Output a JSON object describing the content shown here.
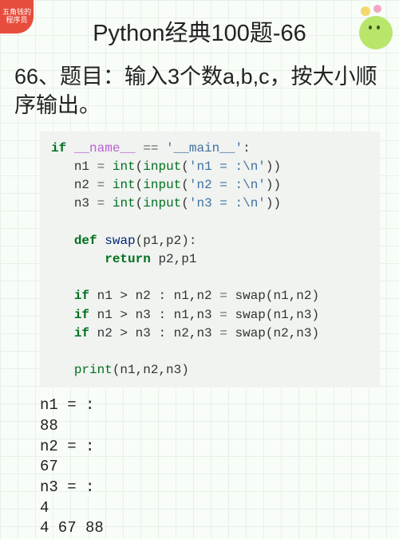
{
  "badge": {
    "line1": "五角钱的",
    "line2": "程序员"
  },
  "title": "Python经典100题-66",
  "question": "66、题目：输入3个数a,b,c，按大小顺序输出。",
  "code": {
    "l1_if": "if",
    "l1_name": "__name__",
    "l1_eq": "==",
    "l1_main": "'__main__'",
    "l2_var": "n1",
    "l2_assign": "=",
    "l2_int": "int",
    "l2_input": "input",
    "l2_str": "'n1 = :\\n'",
    "l3_var": "n2",
    "l3_str": "'n2 = :\\n'",
    "l4_var": "n3",
    "l4_str": "'n3 = :\\n'",
    "def": "def",
    "swap": "swap",
    "params": "(p1,p2):",
    "return": "return",
    "retvals": "p2,p1",
    "if2": "if",
    "cond1": "n1 > n2 : n1,n2",
    "cond2": "n1 > n3 : n1,n3",
    "cond3": "n2 > n3 : n2,n3",
    "eq": "=",
    "call1": "swap(n1,n2)",
    "call2": "swap(n1,n3)",
    "call3": "swap(n2,n3)",
    "print": "print",
    "printargs": "(n1,n2,n3)"
  },
  "output": "n1 = :\n88\nn2 = :\n67\nn3 = :\n4\n4 67 88"
}
